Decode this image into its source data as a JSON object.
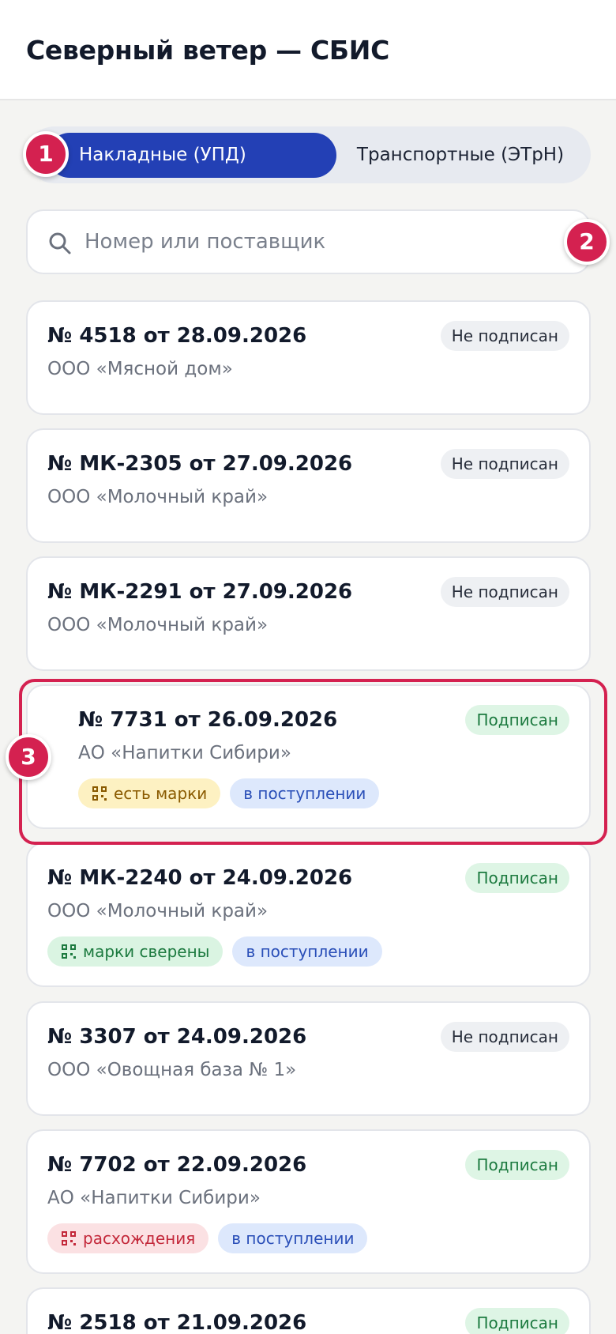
{
  "header": {
    "title": "Северный ветер — СБИС"
  },
  "tabs": {
    "active": "Накладные (УПД)",
    "inactive": "Транспортные (ЭТрН)"
  },
  "search": {
    "placeholder": "Номер или поставщик"
  },
  "documents": [
    {
      "title": "№ 4518 от 28.09.2026",
      "supplier": "ООО «Мясной дом»",
      "status": "Не подписан"
    },
    {
      "title": "№ МК-2305 от 27.09.2026",
      "supplier": "ООО «Молочный край»",
      "status": "Не подписан"
    },
    {
      "title": "№ МК-2291 от 27.09.2026",
      "supplier": "ООО «Молочный край»",
      "status": "Не подписан"
    },
    {
      "title": "№ 7731 от 26.09.2026",
      "supplier": "АО «Напитки Сибири»",
      "status": "Подписан",
      "tag1": "есть марки",
      "tag2": "в поступлении"
    },
    {
      "title": "№ МК-2240 от 24.09.2026",
      "supplier": "ООО «Молочный край»",
      "status": "Подписан",
      "tag1": "марки сверены",
      "tag2": "в поступлении"
    },
    {
      "title": "№ 3307 от 24.09.2026",
      "supplier": "ООО «Овощная база № 1»",
      "status": "Не подписан"
    },
    {
      "title": "№ 7702 от 22.09.2026",
      "supplier": "АО «Напитки Сибири»",
      "status": "Подписан",
      "tag1": "расхождения",
      "tag2": "в поступлении"
    },
    {
      "title": "№ 2518 от 21.09.2026",
      "status": "Подписан"
    }
  ],
  "markers": [
    "1",
    "2",
    "3"
  ],
  "colors": {
    "accent": "#2340b5",
    "marker": "#d42150",
    "signed": "#1c7a3f",
    "tag_yellow": "#8a5a00",
    "tag_red": "#c3283a",
    "tag_blue": "#2a4fb8"
  },
  "icons": [
    "search-icon",
    "qr-code-icon"
  ]
}
